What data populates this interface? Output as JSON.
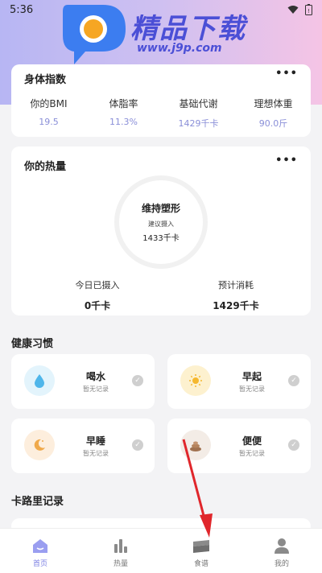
{
  "status_bar": {
    "time": "5:36"
  },
  "watermark": {
    "title": "精品下载",
    "url": "www.j9p.com"
  },
  "body_index": {
    "title": "身体指数",
    "more": "•••",
    "items": [
      {
        "label": "你的BMI",
        "value": "19.5"
      },
      {
        "label": "体脂率",
        "value": "11.3%"
      },
      {
        "label": "基础代谢",
        "value": "1429千卡"
      },
      {
        "label": "理想体重",
        "value": "90.0斤"
      }
    ]
  },
  "calories": {
    "title": "你的热量",
    "more": "•••",
    "ring_title": "维持塑形",
    "ring_subtitle": "建议摄入",
    "ring_value": "1433千卡",
    "intake_label": "今日已摄入",
    "intake_value": "0千卡",
    "burn_label": "预计消耗",
    "burn_value": "1429千卡"
  },
  "habits": {
    "title": "健康习惯",
    "items": [
      {
        "name": "喝水",
        "status": "暂无记录",
        "icon": "water-drop-icon"
      },
      {
        "name": "早起",
        "status": "暂无记录",
        "icon": "sun-icon"
      },
      {
        "name": "早睡",
        "status": "暂无记录",
        "icon": "moon-icon"
      },
      {
        "name": "便便",
        "status": "暂无记录",
        "icon": "poop-icon"
      }
    ]
  },
  "calorie_record": {
    "title": "卡路里记录"
  },
  "nav": {
    "items": [
      {
        "label": "首页",
        "icon": "home-icon",
        "active": true
      },
      {
        "label": "热量",
        "icon": "bar-chart-icon",
        "active": false
      },
      {
        "label": "食谱",
        "icon": "recipe-icon",
        "active": false
      },
      {
        "label": "我的",
        "icon": "profile-icon",
        "active": false
      }
    ]
  },
  "colors": {
    "accent": "#7b7fe3",
    "value_text": "#8a8fd8",
    "annotation_arrow": "#e0262b"
  }
}
